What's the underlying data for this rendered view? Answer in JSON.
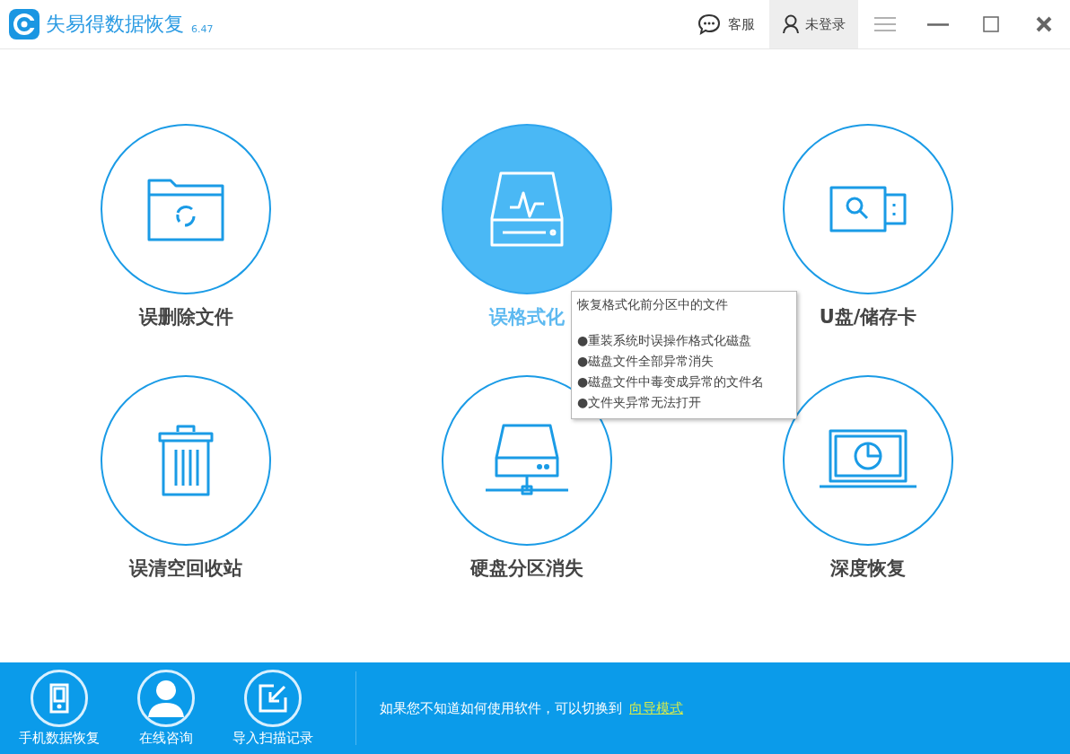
{
  "window": {
    "title": "失易得数据恢复",
    "version": "6.47"
  },
  "header": {
    "service": "客服",
    "login": "未登录"
  },
  "modes": [
    {
      "label": "误删除文件",
      "kind": "folder",
      "selected": false
    },
    {
      "label": "误格式化",
      "kind": "drive",
      "selected": true
    },
    {
      "label": "U盘/储存卡",
      "kind": "usb",
      "selected": false
    },
    {
      "label": "误清空回收站",
      "kind": "trash",
      "selected": false
    },
    {
      "label": "硬盘分区消失",
      "kind": "server",
      "selected": false
    },
    {
      "label": "深度恢复",
      "kind": "laptop",
      "selected": false
    }
  ],
  "tooltip": {
    "title": "恢复格式化前分区中的文件",
    "items": [
      "●重装系统时误操作格式化磁盘",
      "●磁盘文件全部异常消失",
      "●磁盘文件中毒变成异常的文件名",
      "●文件夹异常无法打开"
    ]
  },
  "footer": {
    "tools": [
      {
        "label": "手机数据恢复",
        "kind": "phone"
      },
      {
        "label": "在线咨询",
        "kind": "person"
      },
      {
        "label": "导入扫描记录",
        "kind": "import"
      }
    ],
    "hint": "如果您不知道如何使用软件，可以切换到",
    "link": "向导模式"
  }
}
